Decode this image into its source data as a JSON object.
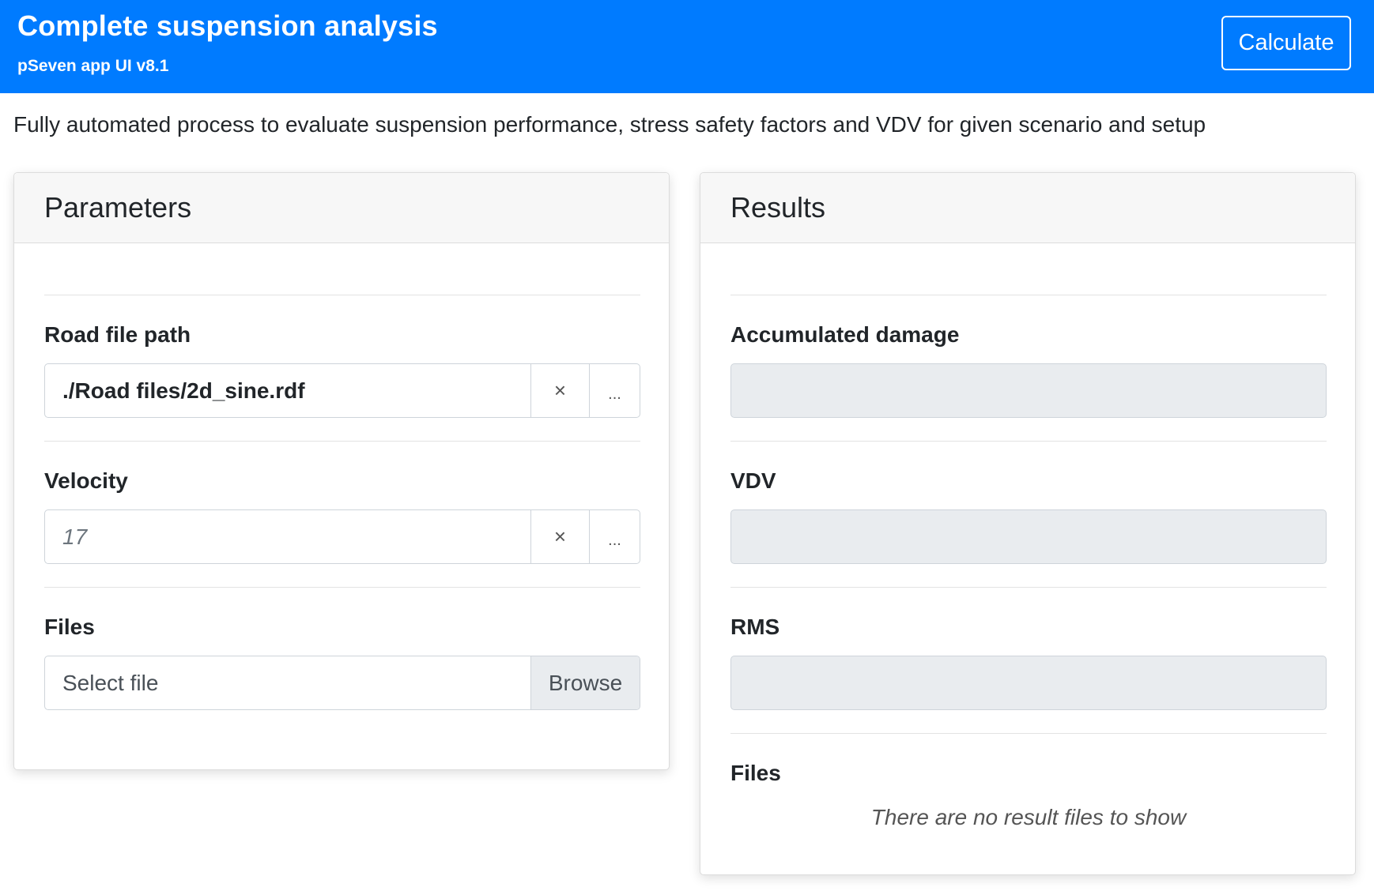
{
  "header": {
    "title": "Complete suspension analysis",
    "version": "pSeven app UI v8.1",
    "calculate_label": "Calculate"
  },
  "description": "Fully automated process to evaluate suspension performance, stress safety factors and VDV for given scenario and setup",
  "parameters": {
    "title": "Parameters",
    "road_file": {
      "label": "Road file path",
      "value": "./Road files/2d_sine.rdf",
      "clear_icon": "×",
      "more_icon": "..."
    },
    "velocity": {
      "label": "Velocity",
      "placeholder": "17",
      "clear_icon": "×",
      "more_icon": "..."
    },
    "files": {
      "label": "Files",
      "placeholder": "Select file",
      "browse_label": "Browse"
    }
  },
  "results": {
    "title": "Results",
    "accumulated_damage": {
      "label": "Accumulated damage",
      "value": ""
    },
    "vdv": {
      "label": "VDV",
      "value": ""
    },
    "rms": {
      "label": "RMS",
      "value": ""
    },
    "files": {
      "label": "Files",
      "empty_message": "There are no result files to show"
    }
  },
  "colors": {
    "header_bg": "#007bff",
    "readonly_bg": "#e9ecef"
  }
}
